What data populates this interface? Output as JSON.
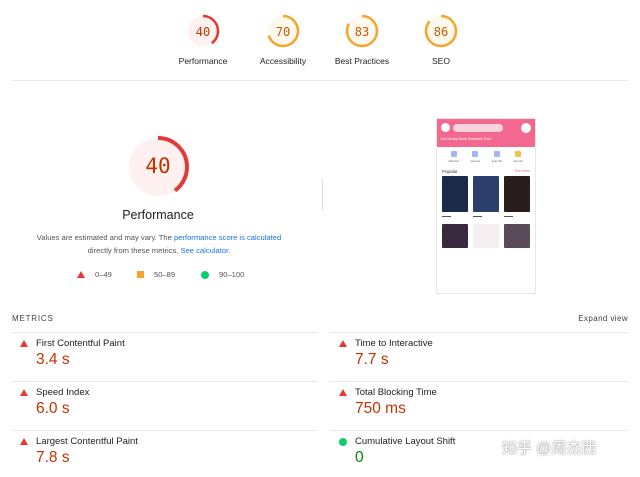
{
  "colors": {
    "fail": "#e53935",
    "fail_text": "#c33300",
    "average": "#f3a52e",
    "average_text": "#c05b00",
    "pass": "#0cce6b",
    "pass_text": "#008800",
    "link": "#1a73e8"
  },
  "gauges": [
    {
      "score": "40",
      "label": "Performance",
      "fraction": 0.4,
      "rating": "fail"
    },
    {
      "score": "70",
      "label": "Accessibility",
      "fraction": 0.7,
      "rating": "average"
    },
    {
      "score": "83",
      "label": "Best Practices",
      "fraction": 0.83,
      "rating": "average"
    },
    {
      "score": "86",
      "label": "SEO",
      "fraction": 0.86,
      "rating": "average"
    }
  ],
  "performance": {
    "score": "40",
    "fraction": 0.4,
    "title": "Performance",
    "desc_prefix": "Values are estimated and may vary. The",
    "desc_link1": "performance score is calculated",
    "desc_middle": "directly from these metrics.",
    "desc_link2": "See calculator.",
    "legend": [
      {
        "icon": "triangle-icon",
        "range": "0–49"
      },
      {
        "icon": "square-icon",
        "range": "50–89"
      },
      {
        "icon": "circle-icon",
        "range": "90–100"
      }
    ]
  },
  "thumbnail": {
    "tabs": "Hot  Library  Book  Romantic  Free",
    "popular": "Popular",
    "see_more": "See more",
    "categories": [
      "Ranked",
      "Genres",
      "Just-Ok",
      "Events"
    ],
    "book_colors": [
      "#1c2a4a",
      "#2c3e6b",
      "#2a1d1d"
    ],
    "book2_colors": [
      "#3a2a3f",
      "#f4eef0",
      "#5a4a5a"
    ]
  },
  "metrics": {
    "title": "METRICS",
    "expand": "Expand view",
    "items": [
      {
        "name": "First Contentful Paint",
        "value": "3.4 s",
        "rating": "fail"
      },
      {
        "name": "Time to Interactive",
        "value": "7.7 s",
        "rating": "fail"
      },
      {
        "name": "Speed Index",
        "value": "6.0 s",
        "rating": "fail"
      },
      {
        "name": "Total Blocking Time",
        "value": "750 ms",
        "rating": "fail"
      },
      {
        "name": "Largest Contentful Paint",
        "value": "7.8 s",
        "rating": "fail"
      },
      {
        "name": "Cumulative Layout Shift",
        "value": "0",
        "rating": "pass"
      }
    ]
  },
  "watermark": "知乎 @周杰西"
}
